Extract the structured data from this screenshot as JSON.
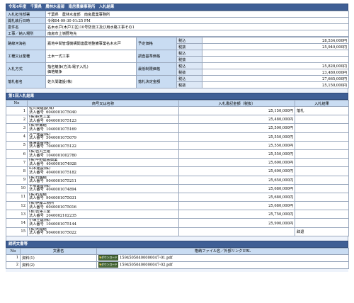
{
  "title": "令和4年度　千葉県　農林水産部　南房農業事務所　入札結果",
  "info": {
    "rows": [
      {
        "label": "入札担当部署",
        "value": "千葉県　農林水産部　南房農業事務所"
      },
      {
        "label": "開札執行日時",
        "value": "令和04-09-30 01:25 PM"
      },
      {
        "label": "案件名",
        "value": "名木水戸(木戸工区)10号防流工及び用水路工事その1"
      },
      {
        "label": "工事／納入場所",
        "value": "南房市上嶺野地先"
      }
    ],
    "route_label": "路線河海名",
    "route_value": "嘉地中間管理機構関連農地整備事業名木水戸",
    "work_type_label": "工種又は業種",
    "work_type_value": "土木一式工事",
    "method_label": "入札方式",
    "method_value_1": "指名競争(方法:電子入札)",
    "method_value_2": "価格競争",
    "winner_label": "落札者名",
    "winner_value": "佐久間建設(株)",
    "planned_label": "予定価格",
    "survey_label": "調査基準価格",
    "min_label": "最低制限価格",
    "award_label": "落札決定金額",
    "tax_excl": "税込",
    "tax_incl": "税抜",
    "planned_1": "28,534,000円",
    "planned_2": "25,940,000円",
    "survey_1": "",
    "survey_2": "",
    "min_1": "25,828,000円",
    "min_2": "23,480,000円",
    "award_1": "27,665,000円",
    "award_2": "25,150,000円"
  },
  "round": {
    "title": "第1回入札結果",
    "col_no": "No",
    "col_name": "商号又は名称",
    "col_amount": "入札書記金額（税抜）",
    "col_result": "入札結果",
    "houjin": "法人番号",
    "rows": [
      {
        "no": "1",
        "name": "佐久間建設(株)",
        "id": "6040001075040",
        "amount": "25,150,000円",
        "result": "落札"
      },
      {
        "no": "2",
        "name": "(株)鈴木工業",
        "id": "6040001075123",
        "amount": "25,480,000円",
        "result": ""
      },
      {
        "no": "3",
        "name": "(株)仲瀬組",
        "id": "1040001075169",
        "amount": "25,500,000円",
        "result": ""
      },
      {
        "no": "4",
        "name": "丸一建設(株)",
        "id": "5040001075079",
        "amount": "25,550,000円",
        "result": ""
      },
      {
        "no": "5",
        "name": "鉄澤建設(株)",
        "id": "7040001075122",
        "amount": "25,550,000円",
        "result": ""
      },
      {
        "no": "6",
        "name": "(株)吉丸土建",
        "id": "1040001002780",
        "amount": "25,550,000円",
        "result": ""
      },
      {
        "no": "7",
        "name": "(株)平野建設興業",
        "id": "4040001074928",
        "amount": "25,600,000円",
        "result": ""
      },
      {
        "no": "8",
        "name": "山本建設(株)",
        "id": "4040001075182",
        "amount": "25,600,000円",
        "result": ""
      },
      {
        "no": "9",
        "name": "(株)日鶴組",
        "id": "9040001075211",
        "amount": "25,650,000円",
        "result": ""
      },
      {
        "no": "10",
        "name": "平塚建設(株)",
        "id": "4040001074894",
        "amount": "25,680,000円",
        "result": ""
      },
      {
        "no": "11",
        "name": "(株)石原組",
        "id": "9040001075031",
        "amount": "25,680,000円",
        "result": ""
      },
      {
        "no": "12",
        "name": "(株)伊藤工務所",
        "id": "6040001075016",
        "amount": "25,680,000円",
        "result": ""
      },
      {
        "no": "13",
        "name": "(有)吉澤工業",
        "id": "2040002102235",
        "amount": "25,750,000円",
        "result": ""
      },
      {
        "no": "14",
        "name": "小澤土建(株)",
        "id": "1040001075144",
        "amount": "25,900,000円",
        "result": ""
      },
      {
        "no": "15",
        "name": "(株)大森組",
        "id": "9040001075022",
        "amount": "",
        "result": "辞退"
      }
    ]
  },
  "docs": {
    "title": "説明文書等",
    "col_no": "No",
    "col_name": "文書名",
    "col_file": "格納ファイル名／外部リンクURL",
    "download_label": "ダウンロード",
    "rows": [
      {
        "no": "1",
        "name": "資料(1)",
        "file": "15945050400000047-01.pdf"
      },
      {
        "no": "2",
        "name": "資料(2)",
        "file": "15945050400000047-02.pdf"
      }
    ]
  }
}
